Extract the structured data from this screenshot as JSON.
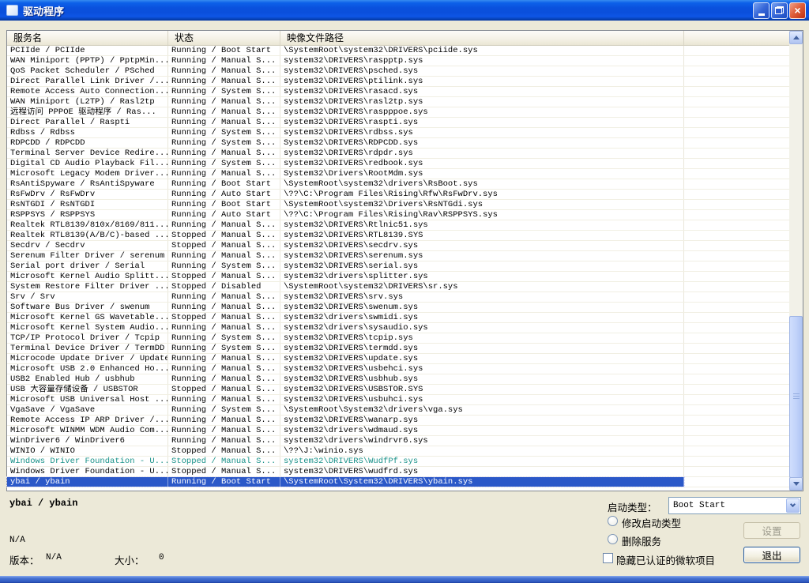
{
  "window": {
    "title": "驱动程序"
  },
  "icons": {
    "close_glyph": "×"
  },
  "colors": {
    "selection_blue": "#2B58C8",
    "teal_row_text": "#189188",
    "dialog_background": "#ECE9D8",
    "titlebar_blue": "#0A51DD"
  },
  "list": {
    "columns": [
      "服务名",
      "状态",
      "映像文件路径"
    ],
    "selected_index": 42,
    "rows": [
      {
        "name": "PCIIde / PCIIde",
        "status": "Running / Boot Start",
        "path": "\\SystemRoot\\system32\\DRIVERS\\pciide.sys"
      },
      {
        "name": "WAN Miniport (PPTP) / PptpMin...",
        "status": "Running / Manual S...",
        "path": "system32\\DRIVERS\\raspptp.sys"
      },
      {
        "name": "QoS Packet Scheduler / PSched",
        "status": "Running / Manual S...",
        "path": "system32\\DRIVERS\\psched.sys"
      },
      {
        "name": "Direct Parallel Link Driver /...",
        "status": "Running / Manual S...",
        "path": "system32\\DRIVERS\\ptilink.sys"
      },
      {
        "name": "Remote Access Auto Connection...",
        "status": "Running / System S...",
        "path": "system32\\DRIVERS\\rasacd.sys"
      },
      {
        "name": "WAN Miniport (L2TP) / Rasl2tp",
        "status": "Running / Manual S...",
        "path": "system32\\DRIVERS\\rasl2tp.sys"
      },
      {
        "name": "远程访问 PPPOE 驱动程序 / Ras...",
        "status": "Running / Manual S...",
        "path": "system32\\DRIVERS\\raspppoe.sys"
      },
      {
        "name": "Direct Parallel / Raspti",
        "status": "Running / Manual S...",
        "path": "system32\\DRIVERS\\raspti.sys"
      },
      {
        "name": "Rdbss / Rdbss",
        "status": "Running / System S...",
        "path": "system32\\DRIVERS\\rdbss.sys"
      },
      {
        "name": "RDPCDD / RDPCDD",
        "status": "Running / System S...",
        "path": "System32\\DRIVERS\\RDPCDD.sys"
      },
      {
        "name": "Terminal Server Device Redire...",
        "status": "Running / Manual S...",
        "path": "system32\\DRIVERS\\rdpdr.sys"
      },
      {
        "name": "Digital CD Audio Playback Fil...",
        "status": "Running / System S...",
        "path": "system32\\DRIVERS\\redbook.sys"
      },
      {
        "name": "Microsoft Legacy Modem Driver...",
        "status": "Running / Manual S...",
        "path": "System32\\Drivers\\RootMdm.sys"
      },
      {
        "name": "RsAntiSpyware / RsAntiSpyware",
        "status": "Running / Boot Start",
        "path": "\\SystemRoot\\system32\\drivers\\RsBoot.sys"
      },
      {
        "name": "RsFwDrv / RsFwDrv",
        "status": "Running / Auto Start",
        "path": "\\??\\C:\\Program Files\\Rising\\Rfw\\RsFwDrv.sys"
      },
      {
        "name": "RsNTGDI / RsNTGDI",
        "status": "Running / Boot Start",
        "path": "\\SystemRoot\\system32\\Drivers\\RsNTGdi.sys"
      },
      {
        "name": "RSPPSYS / RSPPSYS",
        "status": "Running / Auto Start",
        "path": "\\??\\C:\\Program Files\\Rising\\Rav\\RSPPSYS.sys"
      },
      {
        "name": "Realtek RTL8139/810x/8169/811...",
        "status": "Running / Manual S...",
        "path": "system32\\DRIVERS\\Rtlnic51.sys"
      },
      {
        "name": "Realtek RTL8139(A/B/C)-based ...",
        "status": "Stopped / Manual S...",
        "path": "system32\\DRIVERS\\RTL8139.SYS"
      },
      {
        "name": "Secdrv / Secdrv",
        "status": "Stopped / Manual S...",
        "path": "system32\\DRIVERS\\secdrv.sys"
      },
      {
        "name": "Serenum Filter Driver / serenum",
        "status": "Running / Manual S...",
        "path": "system32\\DRIVERS\\serenum.sys"
      },
      {
        "name": "Serial port driver / Serial",
        "status": "Running / System S...",
        "path": "system32\\DRIVERS\\serial.sys"
      },
      {
        "name": "Microsoft Kernel Audio Splitt...",
        "status": "Stopped / Manual S...",
        "path": "system32\\drivers\\splitter.sys"
      },
      {
        "name": "System Restore Filter Driver ...",
        "status": "Stopped / Disabled",
        "path": "\\SystemRoot\\system32\\DRIVERS\\sr.sys"
      },
      {
        "name": "Srv / Srv",
        "status": "Running / Manual S...",
        "path": "system32\\DRIVERS\\srv.sys"
      },
      {
        "name": "Software Bus Driver / swenum",
        "status": "Running / Manual S...",
        "path": "system32\\DRIVERS\\swenum.sys"
      },
      {
        "name": "Microsoft Kernel GS Wavetable...",
        "status": "Stopped / Manual S...",
        "path": "system32\\drivers\\swmidi.sys"
      },
      {
        "name": "Microsoft Kernel System Audio...",
        "status": "Running / Manual S...",
        "path": "system32\\drivers\\sysaudio.sys"
      },
      {
        "name": "TCP/IP Protocol Driver / Tcpip",
        "status": "Running / System S...",
        "path": "system32\\DRIVERS\\tcpip.sys"
      },
      {
        "name": "Terminal Device Driver / TermDD",
        "status": "Running / System S...",
        "path": "system32\\DRIVERS\\termdd.sys"
      },
      {
        "name": "Microcode Update Driver / Update",
        "status": "Running / Manual S...",
        "path": "system32\\DRIVERS\\update.sys"
      },
      {
        "name": "Microsoft USB 2.0 Enhanced Ho...",
        "status": "Running / Manual S...",
        "path": "system32\\DRIVERS\\usbehci.sys"
      },
      {
        "name": "USB2 Enabled Hub / usbhub",
        "status": "Running / Manual S...",
        "path": "system32\\DRIVERS\\usbhub.sys"
      },
      {
        "name": "USB 大容量存储设备 / USBSTOR",
        "status": "Stopped / Manual S...",
        "path": "system32\\DRIVERS\\USBSTOR.SYS"
      },
      {
        "name": "Microsoft USB Universal Host ...",
        "status": "Running / Manual S...",
        "path": "system32\\DRIVERS\\usbuhci.sys"
      },
      {
        "name": "VgaSave / VgaSave",
        "status": "Running / System S...",
        "path": "\\SystemRoot\\System32\\drivers\\vga.sys"
      },
      {
        "name": "Remote Access IP ARP Driver /...",
        "status": "Running / Manual S...",
        "path": "system32\\DRIVERS\\wanarp.sys"
      },
      {
        "name": "Microsoft WINMM WDM Audio Com...",
        "status": "Running / Manual S...",
        "path": "system32\\drivers\\wdmaud.sys"
      },
      {
        "name": "WinDriver6 / WinDriver6",
        "status": "Running / Manual S...",
        "path": "system32\\drivers\\windrvr6.sys"
      },
      {
        "name": "WINIO / WINIO",
        "status": "Stopped / Manual S...",
        "path": "\\??\\J:\\winio.sys"
      },
      {
        "name": "Windows Driver Foundation - U...",
        "status": "Stopped / Manual S...",
        "path": "system32\\DRIVERS\\WudfPf.sys",
        "teal": true
      },
      {
        "name": "Windows Driver Foundation - U...",
        "status": "Stopped / Manual S...",
        "path": "system32\\DRIVERS\\wudfrd.sys"
      },
      {
        "name": "ybai / ybain",
        "status": "Running / Boot Start",
        "path": "\\SystemRoot\\System32\\DRIVERS\\ybain.sys",
        "selected": true
      }
    ]
  },
  "details": {
    "service_title": "ybai / ybain",
    "description": "N/A",
    "version_label": "版本：",
    "version_value": "N/A",
    "size_label": "大小：",
    "size_value": "0"
  },
  "controls": {
    "startup_type_label": "启动类型：",
    "startup_type_value": "Boot Start",
    "radio_modify": "修改启动类型",
    "radio_delete": "删除服务",
    "checkbox_hide": "隐藏已认证的微软项目",
    "settings_button": "设置",
    "exit_button": "退出"
  }
}
